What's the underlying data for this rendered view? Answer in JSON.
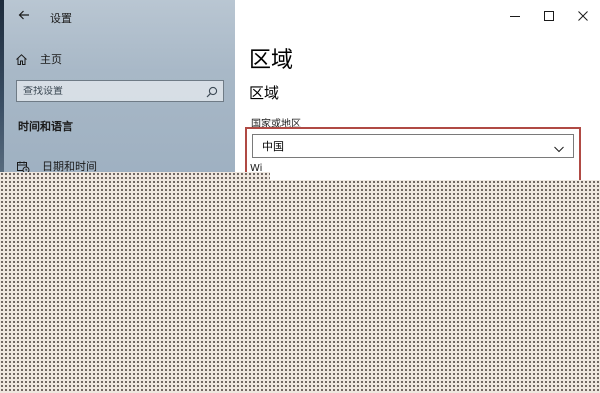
{
  "window": {
    "title": "设置",
    "controls": {
      "minimize": "minimize",
      "maximize": "maximize",
      "close": "close"
    }
  },
  "sidebar": {
    "home_label": "主页",
    "search_placeholder": "查找设置",
    "section_title": "时间和语言",
    "items": [
      {
        "label": "日期和时间",
        "icon": "calendar-clock-icon"
      }
    ]
  },
  "main": {
    "page_title": "区域",
    "section_heading": "区域",
    "country_label": "国家或地区",
    "country_value": "中国",
    "partial_text": "Wi"
  },
  "colors": {
    "highlight": "#b04a44",
    "sidebar_bg": "#a8b8c7"
  }
}
